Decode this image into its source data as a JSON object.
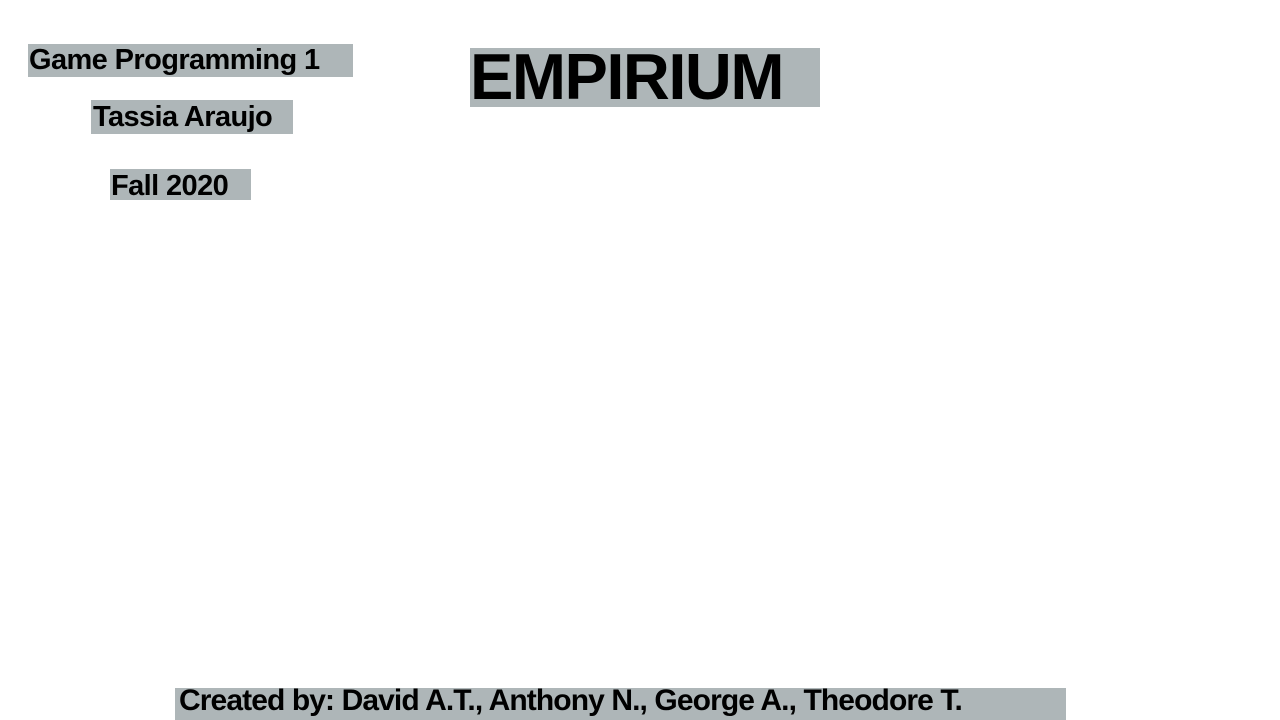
{
  "colors": {
    "background": "#ffffff",
    "label_highlight": "#aeb6b8",
    "text": "#000000"
  },
  "header": {
    "course": "Game Programming 1",
    "instructor": "Tassia Araujo",
    "term": "Fall 2020"
  },
  "title": "EMPIRIUM",
  "footer": {
    "credits": "Created by: David A.T., Anthony N., George A., Theodore T."
  }
}
